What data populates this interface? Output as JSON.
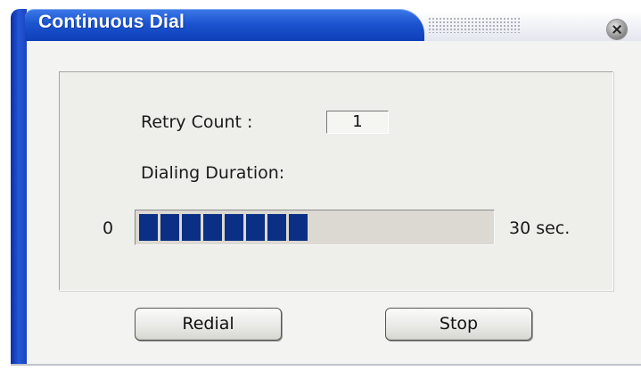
{
  "window": {
    "title": "Continuous Dial",
    "accent_color": "#1c54d0"
  },
  "dialog": {
    "retry_count_label": "Retry Count :",
    "retry_count_value": "1",
    "dialing_duration_label": "Dialing Duration:",
    "progress": {
      "min_label": "0",
      "max_label": "30 sec.",
      "filled_segments": 8,
      "fill_fraction": 0.48,
      "fill_color": "#0b2f84"
    }
  },
  "buttons": {
    "redial_label": "Redial",
    "stop_label": "Stop"
  },
  "icons": {
    "close": "close-icon"
  }
}
